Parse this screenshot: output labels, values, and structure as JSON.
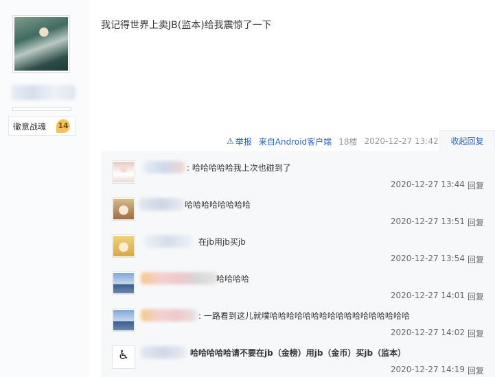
{
  "author": {
    "level_title": "徹意战魂",
    "level": "14"
  },
  "post": {
    "content": "我记得世界上卖JB(监本)给我震惊了一下",
    "report_label": "举报",
    "client_link": "来自Android客户端",
    "floor": "18楼",
    "datetime": "2020-12-27 13:42",
    "collapse_reply": "收起回复"
  },
  "replies": [
    {
      "text": ": 哈哈哈哈哈我上次也碰到了",
      "time": "2020-12-27 13:44",
      "reply": "回复",
      "avatar": "girl-avatar"
    },
    {
      "text": "哈哈哈哈哈哈哈哈",
      "time": "2020-12-27 13:51",
      "reply": "回复",
      "avatar": "anime-avatar"
    },
    {
      "text": "在jb用jb买jb",
      "time": "2020-12-27 13:54",
      "reply": "回复",
      "avatar": "anime-avatar"
    },
    {
      "text": "哈哈哈哈",
      "time": "2020-12-27 14:01",
      "reply": "回复",
      "avatar": "car-avatar"
    },
    {
      "text": ": 一路看到这儿就噗哈哈哈哈哈哈哈哈哈哈哈哈哈哈哈哈哈",
      "time": "2020-12-27 14:02",
      "reply": "回复",
      "avatar": "car-avatar"
    },
    {
      "text": "哈哈哈哈哈请不要在jb（金榜）用jb（金币）买jb（监本）",
      "time": "2020-12-27 14:19",
      "reply": "回复",
      "avatar": "wheelchair-avatar"
    }
  ],
  "colors": {
    "link": "#2d64b3",
    "badge": "#f6c05c",
    "reply_bg": "#f7f8fa"
  }
}
